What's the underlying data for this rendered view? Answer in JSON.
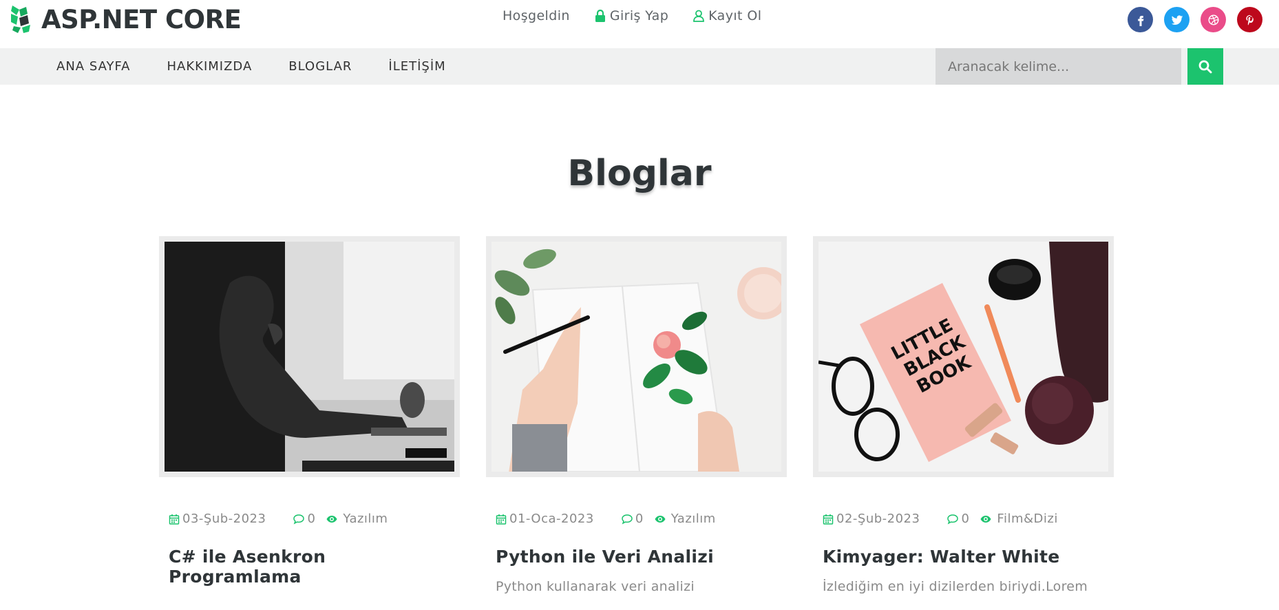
{
  "brand": {
    "name": "ASP.NET CORE"
  },
  "top_links": {
    "welcome": "Hoşgeldin",
    "login": "Giriş Yap",
    "register": "Kayıt Ol"
  },
  "social": [
    "facebook-icon",
    "twitter-icon",
    "dribbble-icon",
    "pinterest-icon"
  ],
  "nav": {
    "home": "ANA SAYFA",
    "about": "HAKKIMIZDA",
    "blogs": "BLOGLAR",
    "contact": "İLETİŞİM"
  },
  "search": {
    "placeholder": "Aranacak kelime..."
  },
  "page": {
    "title": "Bloglar"
  },
  "colors": {
    "accent": "#1cc36e",
    "dark_text": "#2f3538",
    "navbar_bg": "#f0f1f1"
  },
  "posts": [
    {
      "date": "03-Şub-2023",
      "comments": "0",
      "category": "Yazılım",
      "title": "C# ile Asenkron Programlama",
      "excerpt": ""
    },
    {
      "date": "01-Oca-2023",
      "comments": "0",
      "category": "Yazılım",
      "title": "Python ile Veri Analizi",
      "excerpt": "Python kullanarak veri analizi"
    },
    {
      "date": "02-Şub-2023",
      "comments": "0",
      "category": "Film&Dizi",
      "title": "Kimyager: Walter White",
      "excerpt": "İzlediğim en iyi dizilerden biriydi.Lorem"
    }
  ]
}
